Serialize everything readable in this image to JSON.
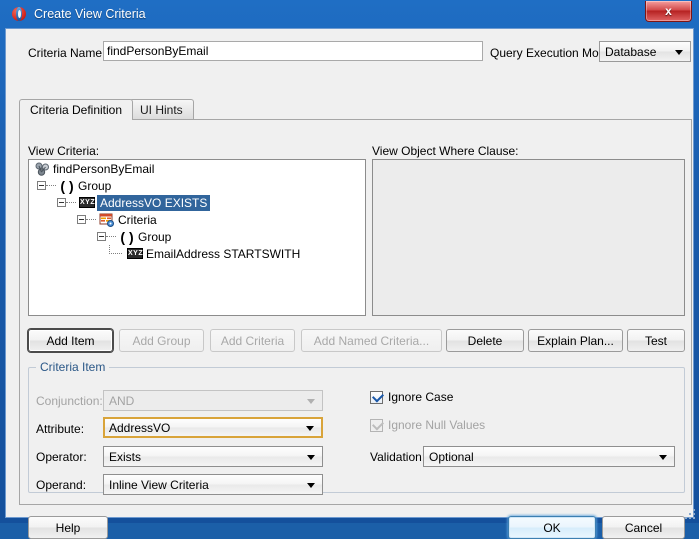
{
  "window": {
    "title": "Create View Criteria",
    "app_icon": "oracle-jdeveloper-icon",
    "close_label": "x"
  },
  "top": {
    "criteria_name_label": "Criteria Name:",
    "criteria_name_value": "findPersonByEmail",
    "criteria_name_placeholder": "",
    "query_execution_mode_label": "Query Execution Mode:",
    "query_execution_mode_value": "Database"
  },
  "tabs": [
    {
      "label": "Criteria Definition",
      "active": true
    },
    {
      "label": "UI Hints",
      "active": false
    }
  ],
  "panels": {
    "view_criteria_label": "View Criteria:",
    "where_clause_label": "View Object Where Clause:",
    "where_clause_value": ""
  },
  "tree": [
    {
      "label": "findPersonByEmail",
      "icon": "view-criteria-root-icon",
      "depth": 0,
      "selected": false,
      "expander": false
    },
    {
      "label": "Group",
      "icon": "paren-group-icon",
      "depth": 1,
      "selected": false,
      "expander": true
    },
    {
      "label": "AddressVO EXISTS",
      "icon": "xyz-attribute-icon",
      "depth": 2,
      "selected": true,
      "expander": true
    },
    {
      "label": "Criteria",
      "icon": "criteria-table-icon",
      "depth": 3,
      "selected": false,
      "expander": true
    },
    {
      "label": "Group",
      "icon": "paren-group-icon",
      "depth": 4,
      "selected": false,
      "expander": true
    },
    {
      "label": "EmailAddress STARTSWITH",
      "icon": "xyz-attribute-icon",
      "depth": 5,
      "selected": false,
      "expander": false
    }
  ],
  "tree_buttons": [
    {
      "name": "add-item",
      "label": "Add Item",
      "mnemonic": "I",
      "enabled": true,
      "focused": true
    },
    {
      "name": "add-group",
      "label": "Add Group",
      "mnemonic": "G",
      "enabled": false,
      "focused": false
    },
    {
      "name": "add-criteria",
      "label": "Add Criteria",
      "mnemonic": "C",
      "enabled": false,
      "focused": false
    },
    {
      "name": "add-named-criteria",
      "label": "Add Named Criteria...",
      "mnemonic": "N",
      "enabled": false,
      "focused": false
    },
    {
      "name": "delete",
      "label": "Delete",
      "mnemonic": "D",
      "enabled": true,
      "focused": false
    },
    {
      "name": "explain-plan",
      "label": "Explain Plan...",
      "mnemonic": "x",
      "enabled": true,
      "focused": false
    },
    {
      "name": "test",
      "label": "Test",
      "mnemonic": "T",
      "enabled": true,
      "focused": false
    }
  ],
  "criteria_item": {
    "group_title": "Criteria Item",
    "conjunction_label": "Conjunction:",
    "conjunction_value": "AND",
    "conjunction_enabled": false,
    "attribute_label": "Attribute:",
    "attribute_value": "AddressVO",
    "attribute_focused": true,
    "operator_label": "Operator:",
    "operator_value": "Exists",
    "operand_label": "Operand:",
    "operand_value": "Inline View Criteria",
    "ignore_case_label": "Ignore Case",
    "ignore_case_checked": true,
    "ignore_case_enabled": true,
    "ignore_null_label": "Ignore Null Values",
    "ignore_null_checked": true,
    "ignore_null_enabled": false,
    "validation_label": "Validation:",
    "validation_value": "Optional"
  },
  "footer": {
    "help_label": "Help",
    "ok_label": "OK",
    "cancel_label": "Cancel"
  },
  "colors": {
    "titlebar_blue": "#1a5bab",
    "selection_blue": "#31659c",
    "focus_gold": "#d9a43a",
    "group_label_blue": "#2a5787",
    "close_red": "#b62222"
  }
}
